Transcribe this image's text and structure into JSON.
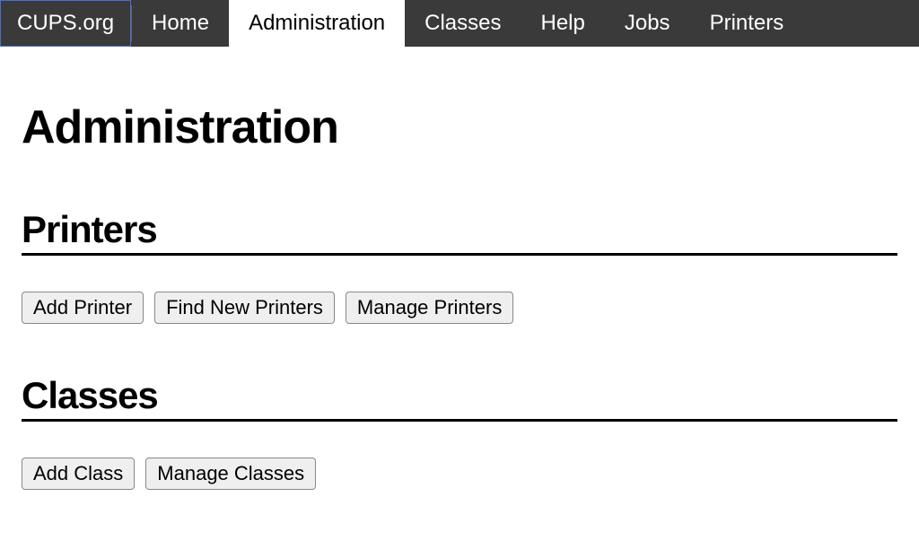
{
  "nav": {
    "brand": "CUPS.org",
    "items": [
      {
        "label": "Home",
        "active": false
      },
      {
        "label": "Administration",
        "active": true
      },
      {
        "label": "Classes",
        "active": false
      },
      {
        "label": "Help",
        "active": false
      },
      {
        "label": "Jobs",
        "active": false
      },
      {
        "label": "Printers",
        "active": false
      }
    ]
  },
  "page": {
    "title": "Administration"
  },
  "sections": {
    "printers": {
      "title": "Printers",
      "buttons": {
        "add": "Add Printer",
        "find": "Find New Printers",
        "manage": "Manage Printers"
      }
    },
    "classes": {
      "title": "Classes",
      "buttons": {
        "add": "Add Class",
        "manage": "Manage Classes"
      }
    }
  }
}
